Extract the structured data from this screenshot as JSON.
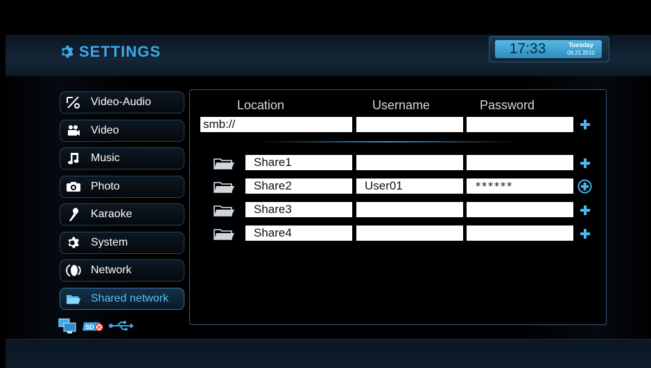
{
  "header": {
    "title": "SETTINGS"
  },
  "clock": {
    "time": "17:33",
    "day": "Tuesday",
    "date": "09.21.2010"
  },
  "sidebar": {
    "items": [
      {
        "label": "Video-Audio",
        "icon": "video-audio-icon"
      },
      {
        "label": "Video",
        "icon": "video-camera-icon"
      },
      {
        "label": "Music",
        "icon": "music-note-icon"
      },
      {
        "label": "Photo",
        "icon": "camera-icon"
      },
      {
        "label": "Karaoke",
        "icon": "microphone-icon"
      },
      {
        "label": "System",
        "icon": "gear-icon"
      },
      {
        "label": "Network",
        "icon": "network-icon"
      },
      {
        "label": "Shared network",
        "icon": "folder-icon",
        "active": true
      }
    ]
  },
  "table": {
    "headers": {
      "location": "Location",
      "username": "Username",
      "password": "Password"
    },
    "new_entry": {
      "location": "smb://",
      "username": "",
      "password": ""
    },
    "shares": [
      {
        "location": "Share1",
        "username": "",
        "password": ""
      },
      {
        "location": "Share2",
        "username": "User01",
        "password": "******"
      },
      {
        "location": "Share3",
        "username": "",
        "password": ""
      },
      {
        "location": "Share4",
        "username": "",
        "password": ""
      }
    ]
  },
  "status_icons": [
    "monitors-icon",
    "sd-card-icon",
    "usb-icon"
  ],
  "colors": {
    "accent": "#3aa9ea",
    "active_label": "#59c0f5",
    "plus": "#4db8f0"
  }
}
